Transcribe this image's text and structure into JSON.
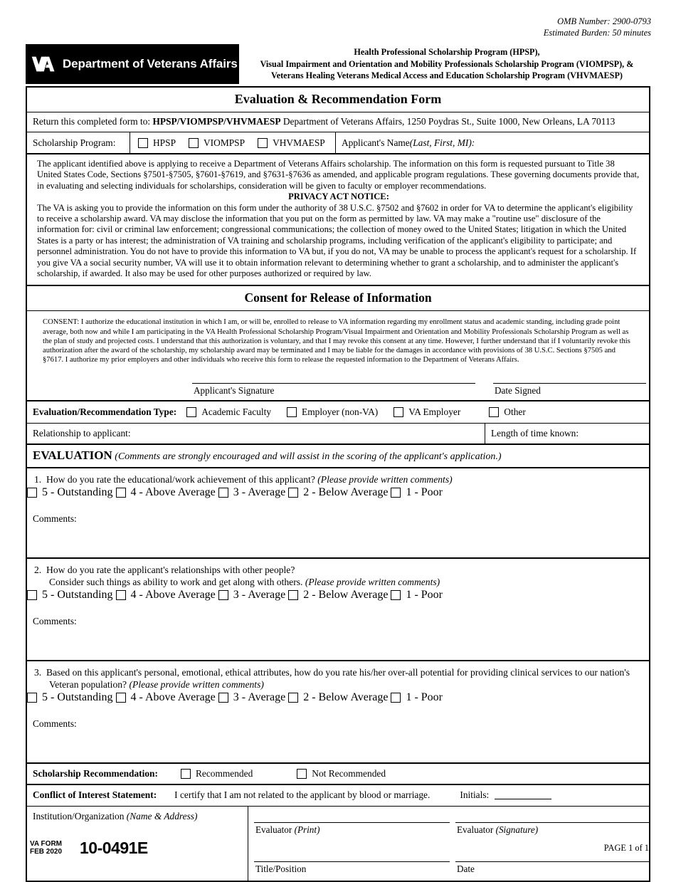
{
  "omb": {
    "number_line": "OMB Number: 2900-0793",
    "burden_line": "Estimated Burden: 50 minutes"
  },
  "header": {
    "agency": "Department of Veterans Affairs",
    "program_line1": "Health Professional Scholarship Program (HPSP),",
    "program_line2": "Visual Impairment and Orientation and Mobility Professionals Scholarship Program (VIOMPSP), &",
    "program_line3": "Veterans Healing Veterans Medical Access and Education Scholarship Program (VHVMAESP)"
  },
  "form": {
    "title": "Evaluation & Recommendation Form",
    "return_prefix": "Return this completed form to: ",
    "return_bold": "HPSP/VIOMPSP/VHVMAESP",
    "return_suffix": " Department of Veterans Affairs, 1250 Poydras St., Suite 1000, New Orleans, LA 70113"
  },
  "scholarship_program": {
    "label": "Scholarship Program:",
    "options": [
      "HPSP",
      "VIOMPSP",
      "VHVMAESP"
    ],
    "applicant_name_label": "Applicant's Name ",
    "applicant_name_italic": "(Last, First, MI):"
  },
  "notice": {
    "para1": "The applicant identified above is applying to receive a Department of Veterans Affairs scholarship. The information on this form is requested pursuant to Title 38 United States Code, Sections §7501-§7505, §7601-§7619, and §7631-§7636 as amended, and applicable program regulations.  These governing documents provide that, in evaluating and selecting individuals for scholarships, consideration will be given to faculty or employer recommendations.",
    "privacy_heading": "PRIVACY ACT NOTICE:",
    "para2": "The VA is asking you to provide the information on this form under the authority of 38 U.S.C. §7502 and §7602 in order for VA to determine the applicant's eligibility to receive a scholarship award. VA may disclose the information that you put on the form as permitted by law. VA may make a \"routine use\" disclosure of the information for: civil or criminal law enforcement; congressional communications; the collection of money owed to the United States; litigation in which the United States is a party or has interest; the administration of VA training and scholarship programs, including verification of the applicant's eligibility to participate; and personnel administration.  You do not have to provide this information to VA but, if you do not, VA may be unable to process the applicant's request for a scholarship. If you give VA a social security number, VA will use it to obtain information relevant to determining whether to grant a scholarship, and to administer the applicant's scholarship, if awarded.  It also may be used for other purposes authorized or required by law."
  },
  "consent": {
    "heading": "Consent for Release of Information",
    "text": "CONSENT: I authorize the educational institution in which I am, or will be, enrolled to release to VA information regarding my enrollment status and academic standing, including grade point average, both now and while I am participating in the VA Health Professional Scholarship Program/Visual Impairment and Orientation and Mobility Professionals Scholarship Program as well as the plan of study and projected costs.  I understand that this authorization is voluntary, and that I may revoke this consent at any time.  However, I further understand that if I voluntarily revoke this authorization after the award of the scholarship, my scholarship award may be terminated and I may be liable for the damages in accordance with provisions of 38 U.S.C. Sections §7505 and §7617.  I authorize my prior employers and other individuals who receive this form to release the requested information to the Department of Veterans Affairs.",
    "signature_caption": "Applicant's Signature",
    "date_caption": "Date Signed"
  },
  "eval_type": {
    "label": "Evaluation/Recommendation Type:",
    "options": [
      "Academic Faculty",
      "Employer (non-VA)",
      "VA Employer",
      "Other"
    ]
  },
  "relationship": {
    "label": "Relationship to applicant:",
    "length_label": "Length of time known:"
  },
  "evaluation": {
    "heading": "EVALUATION",
    "heading_italic": "(Comments are strongly encouraged and will assist in the scoring of the applicant's application.)",
    "rating_options": [
      "5 - Outstanding",
      "4 - Above Average",
      "3 - Average",
      "2 - Below Average",
      "1 - Poor"
    ],
    "comments_label": "Comments:",
    "questions": [
      {
        "number": "1.",
        "text": "How do you rate the educational/work achievement of this applicant? ",
        "italic": "(Please provide written comments)",
        "line2": "",
        "line2_italic": ""
      },
      {
        "number": "2.",
        "text": "How do you rate the applicant's relationships with other people?",
        "italic": "",
        "line2": "Consider such things as ability to work and get along with others. ",
        "line2_italic": "(Please provide written comments)"
      },
      {
        "number": "3.",
        "text": "Based on this applicant's personal, emotional, ethical attributes, how do you rate his/her over-all potential for providing clinical services to our nation's",
        "italic": "",
        "line2": "Veteran population? ",
        "line2_italic": "(Please provide written comments)"
      }
    ]
  },
  "recommendation": {
    "label": "Scholarship Recommendation:",
    "options": [
      "Recommended",
      "Not Recommended"
    ]
  },
  "conflict": {
    "label": "Conflict of Interest Statement:",
    "statement": "I certify that I am not related to the applicant by blood or marriage.",
    "initials_label": "Initials:"
  },
  "institution": {
    "label": "Institution/Organization ",
    "label_italic": "(Name & Address)",
    "evaluator_print": "Evaluator ",
    "evaluator_print_italic": "(Print)",
    "evaluator_signature": "Evaluator ",
    "evaluator_signature_italic": "(Signature)",
    "title_position": "Title/Position",
    "date": "Date"
  },
  "footer": {
    "va_form_line1": "VA FORM",
    "va_form_line2": "FEB 2020",
    "form_number": "10-0491E",
    "page": "PAGE 1 of 1"
  }
}
